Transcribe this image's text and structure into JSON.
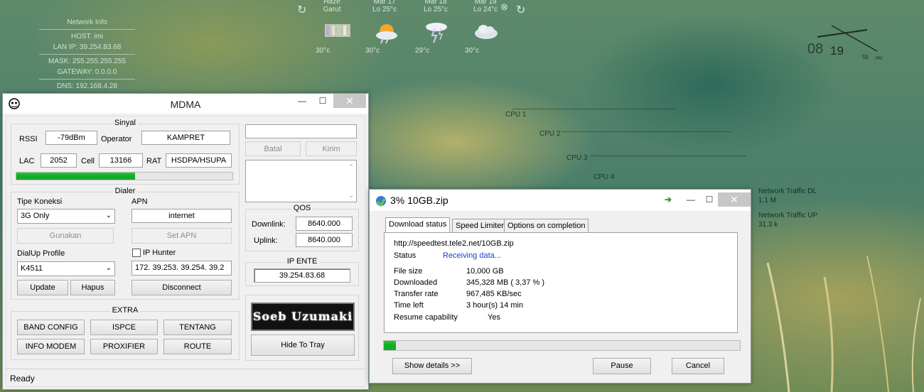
{
  "desktop": {
    "network_info": {
      "title": "Network Info",
      "host": "HOST: imi",
      "lan_ip": "LAN IP: 39.254.83.68",
      "mask": "MASK: 255.255.255.255",
      "gateway": "GATEWAY: 0.0.0.0",
      "dns": "DNS: 192.168.4.28"
    },
    "weather": [
      {
        "day": "Haze",
        "low": "Garut",
        "temp": "30°c",
        "icon": "haze-icon"
      },
      {
        "day": "Mar 17",
        "low": "Lo 25°c",
        "temp": "30°c",
        "icon": "sun-cloud-icon"
      },
      {
        "day": "Mar 18",
        "low": "Lo 25°c",
        "temp": "29°c",
        "icon": "storm-icon"
      },
      {
        "day": "Mar 19",
        "low": "Lo 24°c",
        "temp": "30°c",
        "icon": "cloud-icon"
      }
    ],
    "clock": {
      "hour": "08",
      "minute": "19",
      "second": "55",
      "ampm": "PM"
    },
    "cpu_labels": [
      "CPU 1",
      "CPU 2",
      "CPU 3",
      "CPU 4"
    ],
    "net_traffic": {
      "dl_label": "Network Traffic DL",
      "dl_value": "1.1 M",
      "up_label": "Network Traffic UP",
      "up_value": "31.3 k"
    }
  },
  "mdma": {
    "title": "MDMA",
    "sinyal": {
      "title": "Sinyal",
      "rssi_label": "RSSI",
      "rssi": "-79dBm",
      "operator_label": "Operator",
      "operator": "KAMPRET",
      "lac_label": "LAC",
      "lac": "2052",
      "cell_label": "Cell",
      "cell": "13166",
      "rat_label": "RAT",
      "rat": "HSDPA/HSUPA",
      "signal_level": 0.55
    },
    "dialer": {
      "title": "Dialer",
      "tipe_label": "Tipe Koneksi",
      "tipe_value": "3G Only",
      "apn_label": "APN",
      "apn_value": "internet",
      "gunakan": "Gunakan",
      "set_apn": "Set APN",
      "dialup_label": "DialUp Profile",
      "dialup_value": "K4511",
      "ip_hunter_label": "IP Hunter",
      "ip_hunter_value": "172. 39.253. 39.254. 39.2",
      "update": "Update",
      "hapus": "Hapus",
      "disconnect": "Disconnect"
    },
    "extra": {
      "title": "EXTRA",
      "buttons": [
        "BAND CONFIG",
        "ISPCE",
        "TENTANG",
        "INFO MODEM",
        "PROXIFIER",
        "ROUTE"
      ]
    },
    "sms": {
      "batal": "Batal",
      "kirim": "Kirim"
    },
    "qos": {
      "title": "QOS",
      "downlink_label": "Downlink:",
      "downlink": "8640.000",
      "uplink_label": "Uplink:",
      "uplink": "8640.000"
    },
    "ip_ente": {
      "title": "IP ENTE",
      "value": "39.254.83.68"
    },
    "logo_text": "Soeb Uzumaki",
    "hide_to_tray": "Hide To Tray",
    "status": "Ready"
  },
  "idm": {
    "title": "3% 10GB.zip",
    "tabs": [
      "Download status",
      "Speed Limiter",
      "Options on completion"
    ],
    "url": "http://speedtest.tele2.net/10GB.zip",
    "status_label": "Status",
    "status_value": "Receiving data...",
    "rows": [
      {
        "label": "File size",
        "value": "10,000  GB"
      },
      {
        "label": "Downloaded",
        "value": "345,328  MB  ( 3,37 % )"
      },
      {
        "label": "Transfer rate",
        "value": "967,485  KB/sec"
      },
      {
        "label": "Time left",
        "value": "3 hour(s) 14 min"
      },
      {
        "label": "Resume capability",
        "value": "Yes"
      }
    ],
    "progress": 0.0337,
    "show_details": "Show details >>",
    "pause": "Pause",
    "cancel": "Cancel",
    "accent": "#06b025",
    "status_color": "#1a3fd0"
  }
}
